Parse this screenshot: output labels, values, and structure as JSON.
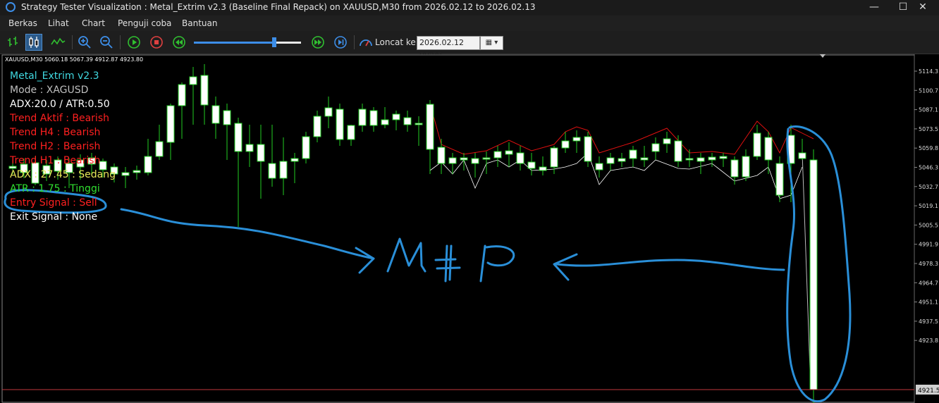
{
  "window": {
    "title": "Strategy Tester Visualization : Metal_Extrim v2.3 (Baseline Final Repack) on XAUUSD,M30 from 2026.02.12 to 2026.02.13",
    "minimize": "—",
    "maximize": "☐",
    "close": "✕"
  },
  "menu": {
    "items": [
      "Berkas",
      "Lihat",
      "Chart",
      "Penguji coba",
      "Bantuan"
    ]
  },
  "toolbar": {
    "icons": [
      "bar-chart-icon",
      "candlestick-icon",
      "line-chart-icon",
      "zoom-in-icon",
      "zoom-out-icon",
      "play-icon",
      "stop-icon",
      "rewind-icon",
      "fast-forward-icon",
      "skip-icon",
      "jump-to-icon",
      "calendar-icon"
    ],
    "speed_level": 0.75,
    "jump_label": "Loncat ke",
    "date_value": "2026.02.12 00:00"
  },
  "chart": {
    "symbol_info": "XAUUSD,M30  5060.18 5067.39 4912.87 4923.80",
    "current_price_label": "4921.5",
    "price_ticks": [
      "5114.3",
      "5100.7",
      "5087.1",
      "5073.5",
      "5059.8",
      "5046.3",
      "5032.7",
      "5019.1",
      "5005.5",
      "4991.9",
      "4978.3",
      "4964.7",
      "4951.1",
      "4937.5",
      "4923.8"
    ],
    "colors": {
      "background": "#000000",
      "bull_candle": "#ffffff",
      "wick": "#22cc22",
      "price_line": "#c0393b",
      "upper_band": "#e01010",
      "lower_band": "#ffffff",
      "annotation": "#2a8fd8"
    },
    "annotation_text": "NFP"
  },
  "overlay": {
    "lines": [
      {
        "text": "Metal_Extrim v2.3",
        "color": "#40d8e0"
      },
      {
        "text": "Mode : XAGUSD",
        "color": "#bfbfbf"
      },
      {
        "text": "ADX:20.0 / ATR:0.50",
        "color": "#ffffff"
      },
      {
        "text": "Trend Aktif : Bearish",
        "color": "#ff2020"
      },
      {
        "text": "Trend H4 : Bearish",
        "color": "#ff2020"
      },
      {
        "text": "Trend H2 : Bearish",
        "color": "#ff2020"
      },
      {
        "text": "Trend H1 : Bearish",
        "color": "#ff2020"
      },
      {
        "text": "ADX : 27.45 : Sedang",
        "color": "#e8e85a"
      },
      {
        "text": "ATR : 1.75 : Tinggi",
        "color": "#30e030"
      },
      {
        "text": "Entry Signal : Sell",
        "color": "#ff2020"
      },
      {
        "text": "Exit Signal : None",
        "color": "#ffffff"
      }
    ]
  }
}
